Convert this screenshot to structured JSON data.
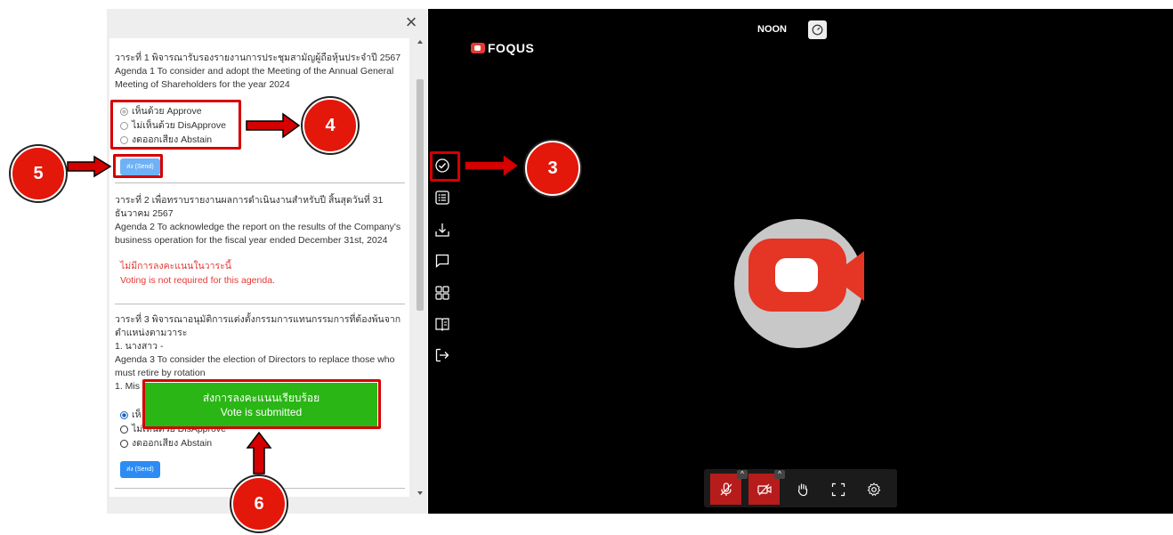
{
  "panel": {
    "close_label": "×",
    "agenda1": {
      "th": "วาระที่ 1 พิจารณารับรองรายงานการประชุมสามัญผู้ถือหุ้นประจำปี 2567",
      "en": "Agenda 1 To consider and adopt the Meeting of the Annual General Meeting of Shareholders for the year 2024",
      "options": [
        "เห็นด้วย Approve",
        "ไม่เห็นด้วย DisApprove",
        "งดออกเสียง Abstain"
      ],
      "selected": 0,
      "send_label": "ส่ง (Send)"
    },
    "agenda2": {
      "th": "วาระที่ 2 เพื่อทราบรายงานผลการดำเนินงานสำหรับปี สิ้นสุดวันที่ 31 ธันวาคม 2567",
      "en": "Agenda 2 To acknowledge the report on the results of the Company's business operation for the fiscal year ended December 31st, 2024",
      "no_vote_th": "ไม่มีการลงคะแนนในวาระนี้",
      "no_vote_en": "Voting is not required for this agenda."
    },
    "agenda3": {
      "th": "วาระที่ 3 พิจารณาอนุมัติการแต่งตั้งกรรมการแทนกรรมการที่ต้องพ้นจากตำแหน่งตามวาระ",
      "nominee_th": "1. นางสาว -",
      "en": "Agenda 3 To consider the election of Directors to replace those who must retire by rotation",
      "nominee_en": "1. Mis",
      "options": [
        "เห็",
        "ไม่เห็นด้วย DisApprove",
        "งดออกเสียง Abstain"
      ],
      "selected": 0,
      "send_label": "ส่ง (Send)"
    },
    "toast": {
      "th": "ส่งการลงคะแนนเรียบร้อย",
      "en": "Vote is submitted"
    }
  },
  "video": {
    "brand": "FOQUS",
    "user_name": "NOON",
    "speed_icon": "speedometer-icon",
    "side_tools": [
      "vote-check-icon",
      "agenda-list-icon",
      "download-icon",
      "chat-icon",
      "grid-view-icon",
      "document-book-icon",
      "exit-icon"
    ],
    "controls": [
      "mic-off-icon",
      "camera-off-icon",
      "raise-hand-icon",
      "fullscreen-icon",
      "settings-icon"
    ]
  },
  "annotations": {
    "labels": [
      "3",
      "4",
      "5",
      "6"
    ]
  },
  "colors": {
    "highlight": "#d50000",
    "badge": "#e3170a",
    "toast": "#2ab615",
    "send": "#2c8cf4",
    "alert_text": "#e53935"
  }
}
